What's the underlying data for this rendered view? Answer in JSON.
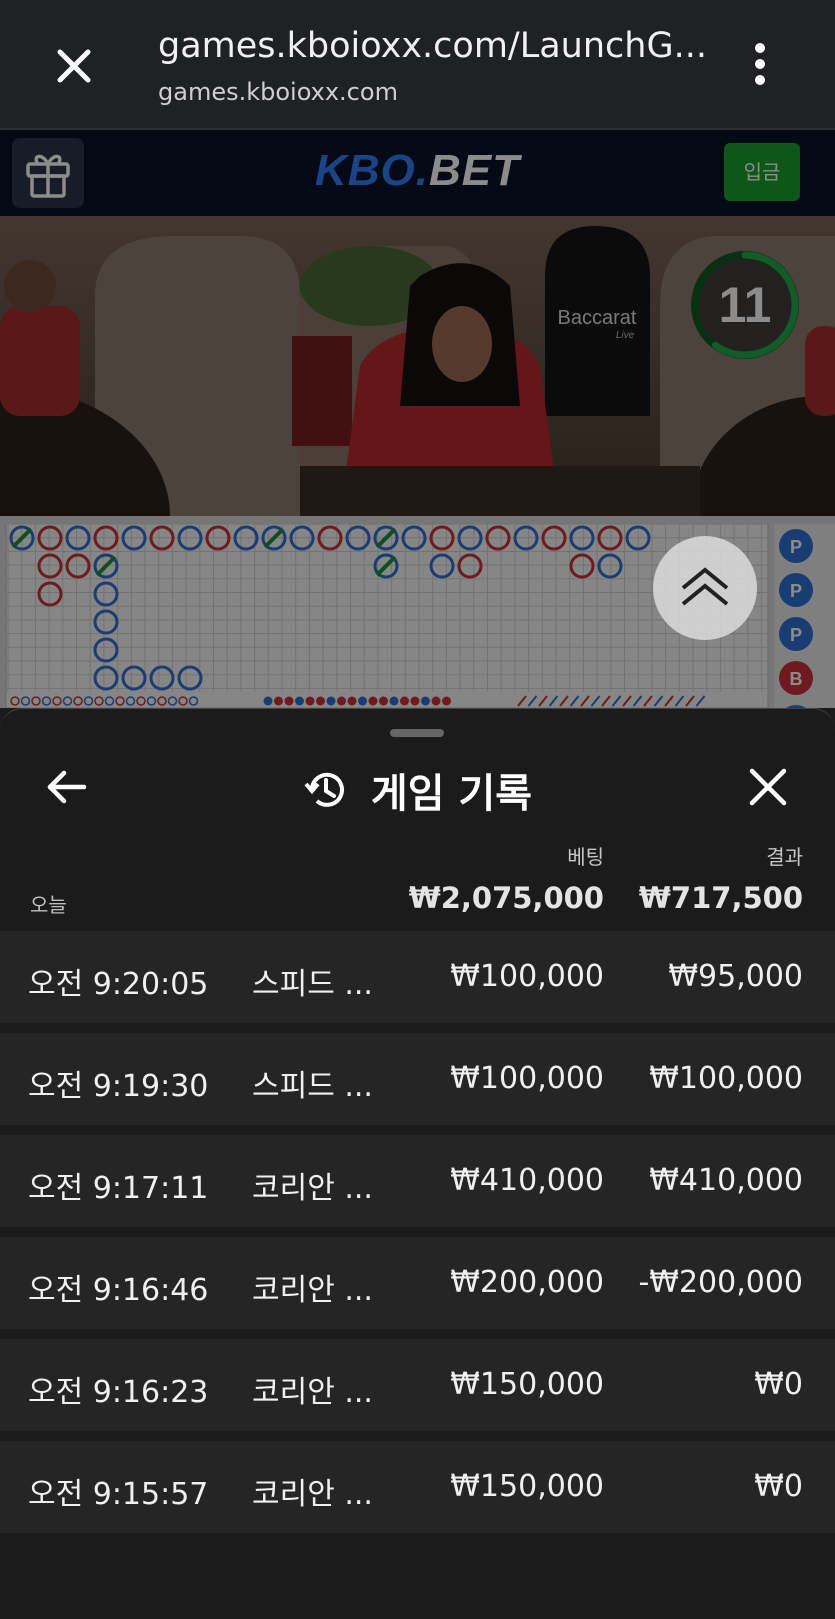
{
  "browser": {
    "url_title": "games.kboioxx.com/LaunchG...",
    "host": "games.kboioxx.com",
    "icons": [
      "close-icon",
      "overflow-menu-icon"
    ]
  },
  "site": {
    "logo_kbo": "KBO.",
    "logo_bet": "BET",
    "deposit_label": "입금",
    "icons": [
      "gift-icon"
    ]
  },
  "game": {
    "countdown": "11",
    "countdown_fraction": 0.6,
    "table_sign_title": "Baccarat",
    "table_sign_sub": "Live",
    "colors": {
      "player": "#2f6fd1",
      "banker": "#c8303a",
      "tie": "#1f8f3a",
      "timer": "#1fa84a"
    }
  },
  "sheet": {
    "title": "게임 기록",
    "icons": [
      "back-arrow-icon",
      "history-icon",
      "close-icon"
    ],
    "header_bet": "베팅",
    "header_result": "결과",
    "today_label": "오늘",
    "total_bet": "₩2,075,000",
    "total_result": "₩717,500",
    "rows": [
      {
        "time": "오전 9:20:05",
        "game": "스피드 ...",
        "bet": "₩100,000",
        "result": "₩95,000"
      },
      {
        "time": "오전 9:19:30",
        "game": "스피드 ...",
        "bet": "₩100,000",
        "result": "₩100,000"
      },
      {
        "time": "오전 9:17:11",
        "game": "코리안 ...",
        "bet": "₩410,000",
        "result": "₩410,000"
      },
      {
        "time": "오전 9:16:46",
        "game": "코리안 ...",
        "bet": "₩200,000",
        "result": "-₩200,000"
      },
      {
        "time": "오전 9:16:23",
        "game": "코리안 ...",
        "bet": "₩150,000",
        "result": "₩0"
      },
      {
        "time": "오전 9:15:57",
        "game": "코리안 ...",
        "bet": "₩150,000",
        "result": "₩0"
      }
    ]
  }
}
